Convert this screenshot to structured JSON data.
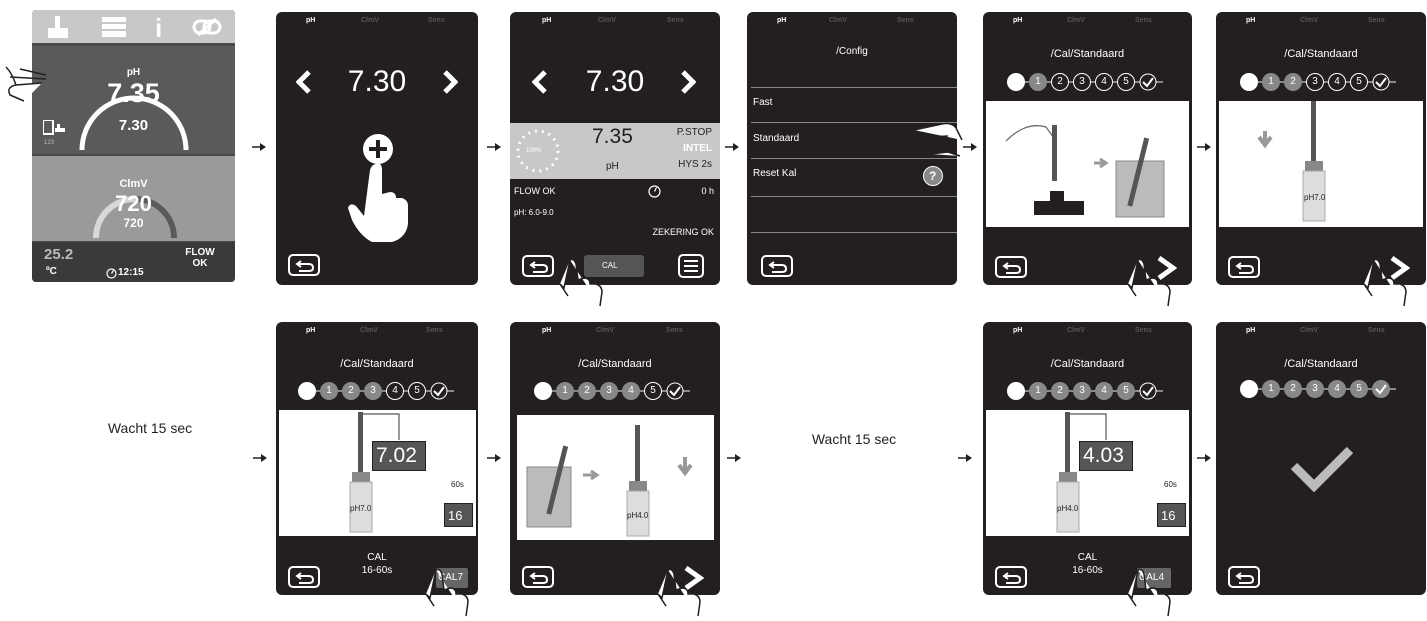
{
  "tabs": {
    "ph": "pH",
    "clmv": "ClmV",
    "sens": "Sens"
  },
  "main": {
    "ph_label": "pH",
    "ph_value": "7.35",
    "ph_setpoint": "7.30",
    "meter_label": "123",
    "clmv_label": "ClmV",
    "clmv_value": "720",
    "clmv_setpoint": "720",
    "temp_value": "25.2",
    "temp_unit": "ºC",
    "time": "12:15",
    "flow_line1": "FLOW",
    "flow_line2": "OK"
  },
  "setpoint": {
    "value": "7.30"
  },
  "home": {
    "setpoint": "7.30",
    "ring_pct": "100%",
    "ph_value": "7.35",
    "ph_label": "pH",
    "pstop": "P.STOP",
    "intel": "INTEL",
    "hys": "HYS 2s",
    "flow": "FLOW OK",
    "hours": "0 h",
    "range": "pH: 6.0-9.0",
    "fuse": "ZEKERING OK",
    "cal_button": "CAL"
  },
  "config": {
    "path": "/Config",
    "items": [
      "Fast",
      "Standaard",
      "Reset Kal"
    ],
    "help": "?"
  },
  "cal": {
    "path": "/Cal/Standaard",
    "steps": [
      "1",
      "2",
      "3",
      "4",
      "5"
    ],
    "bottle_ph7": "pH7.0",
    "bottle_ph4": "pH4.0",
    "reading_ph7": "7.02",
    "reading_ph4": "4.03",
    "time_label": "60s",
    "counter": "16",
    "status_line1": "CAL",
    "status_line2": "16-60s",
    "cal7_button": "CAL7",
    "cal4_button": "CAL4"
  },
  "wait_text": "Wacht 15 sec",
  "colors": {
    "screen": "#231f20",
    "upper_panel": "#5a5a5a",
    "lower_panel": "#9a9a9a",
    "toolbar": "#c8c8c8",
    "accent": "#ffffff"
  }
}
